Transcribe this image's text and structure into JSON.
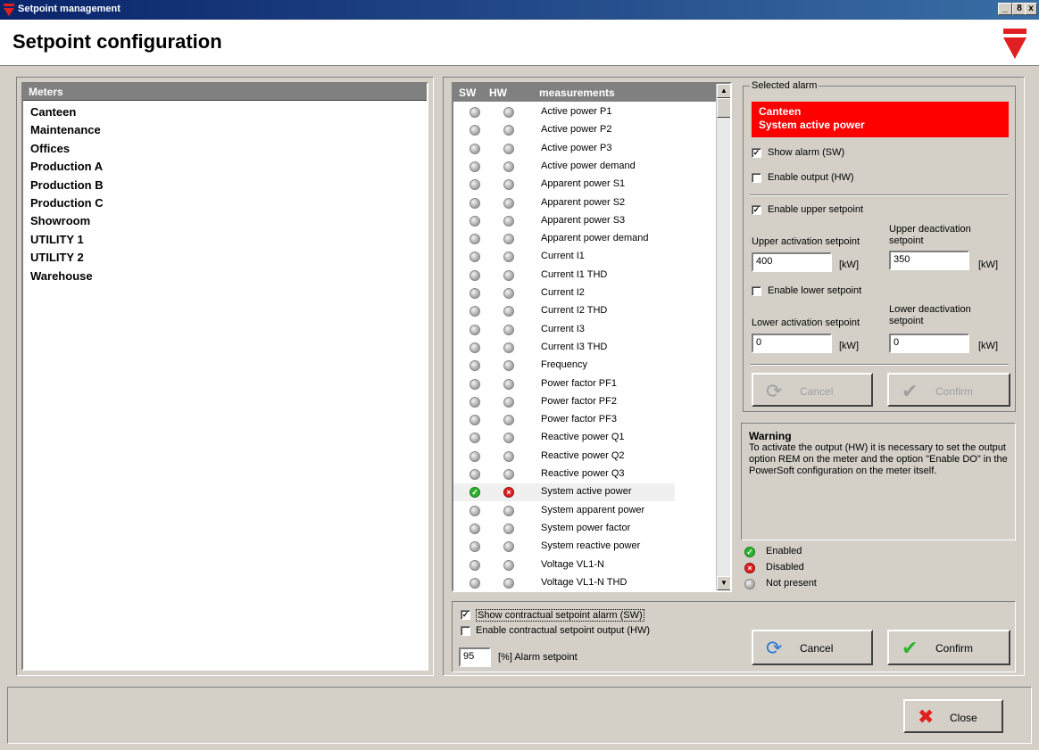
{
  "window": {
    "title": "Setpoint management",
    "minimize": "_",
    "maximize": "8",
    "close": "x"
  },
  "header": {
    "title": "Setpoint configuration"
  },
  "meters": {
    "header": "Meters",
    "items": [
      "Canteen",
      "Maintenance",
      "Offices",
      "Production A",
      "Production B",
      "Production C",
      "Showroom",
      "UTILITY 1",
      "UTILITY 2",
      "Warehouse"
    ]
  },
  "measurements": {
    "col_sw": "SW",
    "col_hw": "HW",
    "col_name": "measurements",
    "rows": [
      {
        "name": "Active power P1",
        "sw": "not-present",
        "hw": "not-present"
      },
      {
        "name": "Active power P2",
        "sw": "not-present",
        "hw": "not-present"
      },
      {
        "name": "Active power P3",
        "sw": "not-present",
        "hw": "not-present"
      },
      {
        "name": "Active power demand",
        "sw": "not-present",
        "hw": "not-present"
      },
      {
        "name": "Apparent power S1",
        "sw": "not-present",
        "hw": "not-present"
      },
      {
        "name": "Apparent power S2",
        "sw": "not-present",
        "hw": "not-present"
      },
      {
        "name": "Apparent power S3",
        "sw": "not-present",
        "hw": "not-present"
      },
      {
        "name": "Apparent power demand",
        "sw": "not-present",
        "hw": "not-present"
      },
      {
        "name": "Current I1",
        "sw": "not-present",
        "hw": "not-present"
      },
      {
        "name": "Current I1 THD",
        "sw": "not-present",
        "hw": "not-present"
      },
      {
        "name": "Current I2",
        "sw": "not-present",
        "hw": "not-present"
      },
      {
        "name": "Current I2 THD",
        "sw": "not-present",
        "hw": "not-present"
      },
      {
        "name": "Current I3",
        "sw": "not-present",
        "hw": "not-present"
      },
      {
        "name": "Current I3 THD",
        "sw": "not-present",
        "hw": "not-present"
      },
      {
        "name": "Frequency",
        "sw": "not-present",
        "hw": "not-present"
      },
      {
        "name": "Power factor PF1",
        "sw": "not-present",
        "hw": "not-present"
      },
      {
        "name": "Power factor PF2",
        "sw": "not-present",
        "hw": "not-present"
      },
      {
        "name": "Power factor PF3",
        "sw": "not-present",
        "hw": "not-present"
      },
      {
        "name": "Reactive power Q1",
        "sw": "not-present",
        "hw": "not-present"
      },
      {
        "name": "Reactive power Q2",
        "sw": "not-present",
        "hw": "not-present"
      },
      {
        "name": "Reactive power Q3",
        "sw": "not-present",
        "hw": "not-present"
      },
      {
        "name": "System active power",
        "sw": "enabled",
        "hw": "disabled",
        "selected": true
      },
      {
        "name": "System apparent power",
        "sw": "not-present",
        "hw": "not-present"
      },
      {
        "name": "System power factor",
        "sw": "not-present",
        "hw": "not-present"
      },
      {
        "name": "System reactive power",
        "sw": "not-present",
        "hw": "not-present"
      },
      {
        "name": "Voltage VL1-N",
        "sw": "not-present",
        "hw": "not-present"
      },
      {
        "name": "Voltage VL1-N THD",
        "sw": "not-present",
        "hw": "not-present"
      }
    ]
  },
  "selected_alarm": {
    "group_label": "Selected alarm",
    "banner_line1": "Canteen",
    "banner_line2": "System active power",
    "banner_color": "#ff0000",
    "show_alarm_label": "Show alarm (SW)",
    "show_alarm_checked": true,
    "enable_output_label": "Enable output (HW)",
    "enable_output_checked": false,
    "enable_upper_label": "Enable upper setpoint",
    "enable_upper_checked": true,
    "upper_activation_label": "Upper activation setpoint",
    "upper_activation_value": "400",
    "upper_activation_unit": "[kW]",
    "upper_deactivation_label1": "Upper deactivation",
    "upper_deactivation_label2": "setpoint",
    "upper_deactivation_value": "350",
    "upper_deactivation_unit": "[kW]",
    "enable_lower_label": "Enable lower setpoint",
    "enable_lower_checked": false,
    "lower_activation_label": "Lower activation setpoint",
    "lower_activation_value": "0",
    "lower_activation_unit": "[kW]",
    "lower_deactivation_label1": "Lower deactivation",
    "lower_deactivation_label2": "setpoint",
    "lower_deactivation_value": "0",
    "lower_deactivation_unit": "[kW]",
    "cancel_label": "Cancel",
    "confirm_label": "Confirm"
  },
  "warning": {
    "title": "Warning",
    "text": "To activate the output (HW) it is necessary to set the output option REM on the meter and the option \"Enable DO\" in the PowerSoft configuration on the meter itself."
  },
  "legend": {
    "enabled": "Enabled",
    "disabled": "Disabled",
    "not_present": "Not present"
  },
  "contractual": {
    "show_label": "Show contractual setpoint alarm  (SW)",
    "show_checked": true,
    "enable_label": "Enable contractual setpoint output (HW)",
    "enable_checked": false,
    "alarm_value": "95",
    "alarm_label": "[%] Alarm setpoint",
    "cancel_label": "Cancel",
    "confirm_label": "Confirm"
  },
  "footer": {
    "close_label": "Close"
  }
}
